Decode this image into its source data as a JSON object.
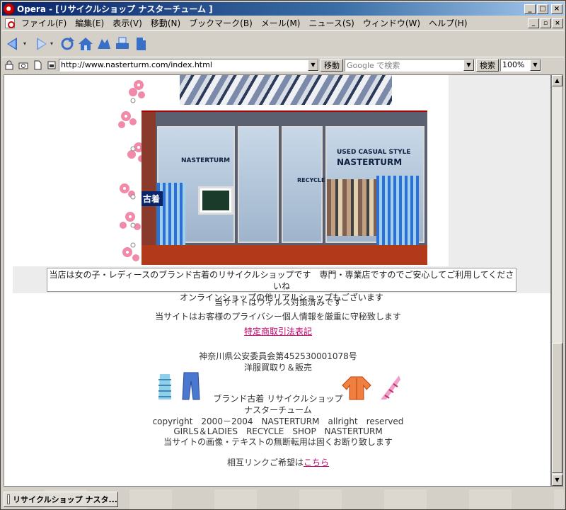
{
  "window": {
    "title": "Opera - [リサイクルショップ ナスターチューム ]",
    "caption_buttons": [
      "_",
      "□",
      "×"
    ],
    "mdi_buttons": [
      "_",
      "▫",
      "×"
    ]
  },
  "menu": {
    "items": [
      "ファイル(F)",
      "編集(E)",
      "表示(V)",
      "移動(N)",
      "ブックマーク(B)",
      "メール(M)",
      "ニュース(S)",
      "ウィンドウ(W)",
      "ヘルプ(H)"
    ]
  },
  "toolbar": {
    "buttons": [
      "back-arrow-icon",
      "forward-arrow-icon",
      "reload-icon",
      "home-icon",
      "hotlist-icon",
      "print-icon",
      "page-icon"
    ]
  },
  "address": {
    "url": "http://www.nasterturm.com/index.html",
    "go_label": "移動",
    "search_placeholder": "Google で検索",
    "search_label": "検索",
    "zoom": "100%"
  },
  "colors": {
    "link": "#c0006a",
    "titlebar_start": "#0a246a",
    "titlebar_end": "#a6caf0"
  },
  "content": {
    "notice_line1": "当店は女の子・レディースのブランド古着のリサイクルショップです　専門・専業店ですのでご安心してご利用してくださいね",
    "notice_line2": "オンラインショップの他リアルショップもございます",
    "photo_labels": {
      "used_casual": "USED CASUAL STYLE",
      "brand": "NASTERTURM",
      "recycle": "RECYCLE",
      "kanji": "古着"
    },
    "virus": "当サイトはウィルス対策済みです",
    "privacy": "当サイトはお客様のプライバシー個人情報を厳重に守秘致します",
    "law_link": "特定商取引法表記",
    "license": "神奈川県公安委員会第452530001078号",
    "business": "洋服買取り＆販売",
    "shop_line1": "ブランド古着 リサイクルショップ",
    "shop_line2": "ナスターチューム",
    "copyright": "copyright　2000－2004　NASTERTURM　allright　reserved",
    "girls": "GIRLS＆LADIES　RECYCLE　SHOP　NASTERTURM",
    "no_copy": "当サイトの画像・テキストの無断転用は固くお断り致します",
    "link_request": "相互リンクご希望は",
    "link_here": "こちら"
  },
  "statusbar": {
    "tab_label": "リサイクルショップ ナスタ..."
  }
}
